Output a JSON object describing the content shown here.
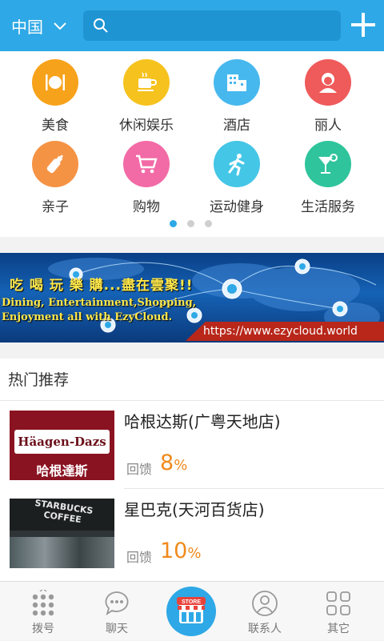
{
  "header": {
    "city": "中国",
    "search_placeholder": ""
  },
  "categories": [
    {
      "label": "美食",
      "icon": "cutlery-icon",
      "color": "#f7a21b"
    },
    {
      "label": "休闲娱乐",
      "icon": "coffee-cup-icon",
      "color": "#f6c21d"
    },
    {
      "label": "酒店",
      "icon": "hotel-building-icon",
      "color": "#46b8ee"
    },
    {
      "label": "丽人",
      "icon": "woman-icon",
      "color": "#ef5a5a"
    },
    {
      "label": "亲子",
      "icon": "baby-bottle-icon",
      "color": "#f59345"
    },
    {
      "label": "购物",
      "icon": "shopping-cart-icon",
      "color": "#f26aa6"
    },
    {
      "label": "运动健身",
      "icon": "running-man-icon",
      "color": "#44c6e6"
    },
    {
      "label": "生活服务",
      "icon": "cocktail-icon",
      "color": "#2fc49c"
    }
  ],
  "pager": {
    "count": 3,
    "active": 0
  },
  "banner": {
    "cn_text": "吃 喝 玩 樂 購...盡在雲聚!!",
    "en_line1": "Dining, Entertainment,Shopping,",
    "en_line2": "Enjoyment all with EzyCloud.",
    "url": "https://www.ezycloud.world"
  },
  "hot": {
    "title": "热门推荐",
    "items": [
      {
        "name": "哈根达斯(广粤天地店)",
        "feedback_label": "回馈",
        "pct_value": "8",
        "pct_sign": "%",
        "logo_text": "Häagen-Dazs",
        "logo_cn": "哈根達斯"
      },
      {
        "name": "星巴克(天河百货店)",
        "feedback_label": "回馈",
        "pct_value": "10",
        "pct_sign": "%",
        "logo_text": "STARBUCKS COFFEE"
      }
    ]
  },
  "tabs": [
    {
      "label": "拨号",
      "icon": "dialpad-icon"
    },
    {
      "label": "聊天",
      "icon": "chat-bubble-icon"
    },
    {
      "label": "STORE",
      "icon": "store-icon"
    },
    {
      "label": "联系人",
      "icon": "contact-icon"
    },
    {
      "label": "其它",
      "icon": "grid-icon"
    }
  ]
}
